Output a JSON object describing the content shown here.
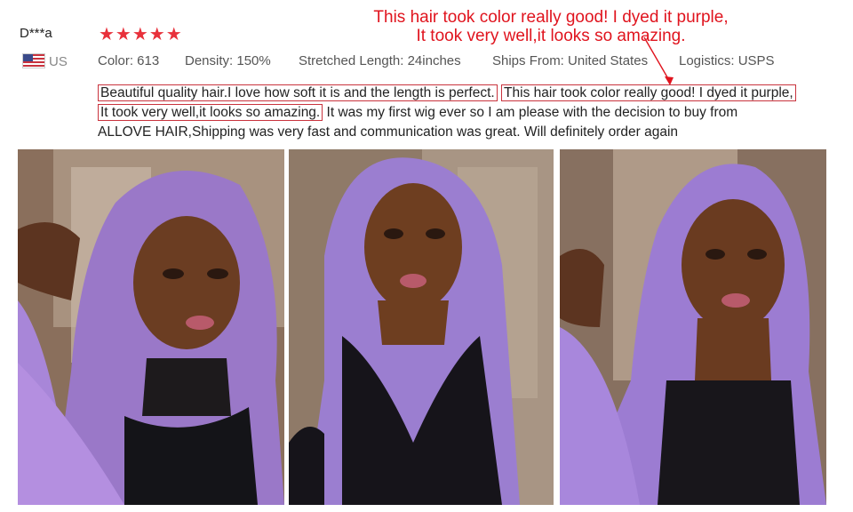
{
  "review": {
    "reviewer": "D***a",
    "stars": "★★★★★",
    "country": "US",
    "flag_icon": "us-flag-icon",
    "details": {
      "color": "Color: 613",
      "density": "Density: 150%",
      "length": "Stretched Length: 24inches",
      "ships_from": "Ships From: United States",
      "logistics": "Logistics: USPS"
    },
    "callout_line1": "This hair took color really good! I dyed it purple,",
    "callout_line2": "It took very well,it looks so amazing.",
    "text_box1": "Beautiful quality hair.I love how soft it is and the length is perfect.",
    "text_box2": "This hair took color really good! I dyed it purple,",
    "text_box3": "It took very well,it looks so amazing.",
    "text_rest": " It was my first wig ever so I am please with the decision to buy from",
    "text_line3": "ALLOVE HAIR,Shipping was very fast and communication was great. Will definitely order again"
  },
  "colors": {
    "star": "#e8313b",
    "callout": "#e0141e",
    "highlight_box": "#c9333d"
  }
}
